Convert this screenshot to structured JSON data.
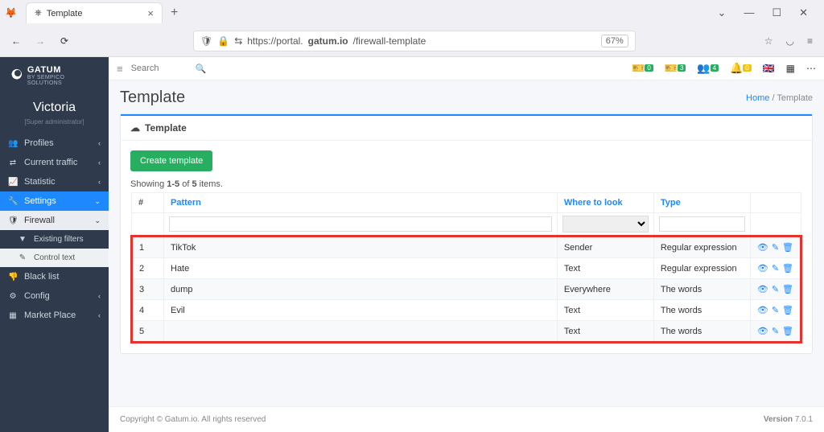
{
  "browser": {
    "tab_title": "Template",
    "url_prefix": "https://portal.",
    "url_host": "gatum.io",
    "url_path": "/firewall-template",
    "zoom": "67%",
    "win": {
      "chevron": "⌄",
      "min": "—",
      "max": "☐",
      "close": "✕"
    }
  },
  "brand": {
    "name": "GATUM",
    "tagline": "BY SEMPICO SOLUTIONS"
  },
  "user": {
    "name": "Victoria",
    "role": "[Super administrator]"
  },
  "sidebar": {
    "items": [
      {
        "icon": "👥",
        "label": "Profiles"
      },
      {
        "icon": "⇄",
        "label": "Current traffic"
      },
      {
        "icon": "📈",
        "label": "Statistic"
      },
      {
        "icon": "🔧",
        "label": "Settings",
        "active": true
      },
      {
        "icon": "🛡",
        "label": "Firewall",
        "expanded": true
      },
      {
        "icon": "▼",
        "label": "Existing filters",
        "sub": true
      },
      {
        "icon": "✎",
        "label": "Control text",
        "sub_active": true
      },
      {
        "icon": "👎",
        "label": "Black list"
      },
      {
        "icon": "⚙",
        "label": "Config"
      },
      {
        "icon": "▦",
        "label": "Market Place"
      }
    ]
  },
  "topbar": {
    "search_placeholder": "Search",
    "badges": [
      {
        "icon": "🎫",
        "count": "0",
        "color": "green"
      },
      {
        "icon": "🎫",
        "count": "3",
        "color": "green"
      },
      {
        "icon": "👥",
        "count": "4",
        "color": "green"
      },
      {
        "icon": "🔔",
        "count": "0",
        "color": "yellow"
      }
    ]
  },
  "page": {
    "title": "Template",
    "panel_title": "Template",
    "breadcrumb_home": "Home",
    "breadcrumb_sep": "/",
    "breadcrumb_current": "Template",
    "create_button": "Create template",
    "showing_prefix": "Showing ",
    "showing_range": "1-5",
    "showing_mid": " of ",
    "showing_total": "5",
    "showing_suffix": " items."
  },
  "table": {
    "headers": {
      "num": "#",
      "pattern": "Pattern",
      "where": "Where to look",
      "type": "Type"
    },
    "rows": [
      {
        "n": "1",
        "pattern": "TikTok",
        "where": "Sender",
        "type": "Regular expression"
      },
      {
        "n": "2",
        "pattern": "Hate",
        "where": "Text",
        "type": "Regular expression"
      },
      {
        "n": "3",
        "pattern": "dump",
        "where": "Everywhere",
        "type": "The words"
      },
      {
        "n": "4",
        "pattern": "Evil",
        "where": "Text",
        "type": "The words"
      },
      {
        "n": "5",
        "pattern": "",
        "where": "Text",
        "type": "The words"
      }
    ]
  },
  "footer": {
    "copyright": "Copyright © Gatum.io. All rights reserved",
    "version_label": "Version ",
    "version": "7.0.1"
  }
}
